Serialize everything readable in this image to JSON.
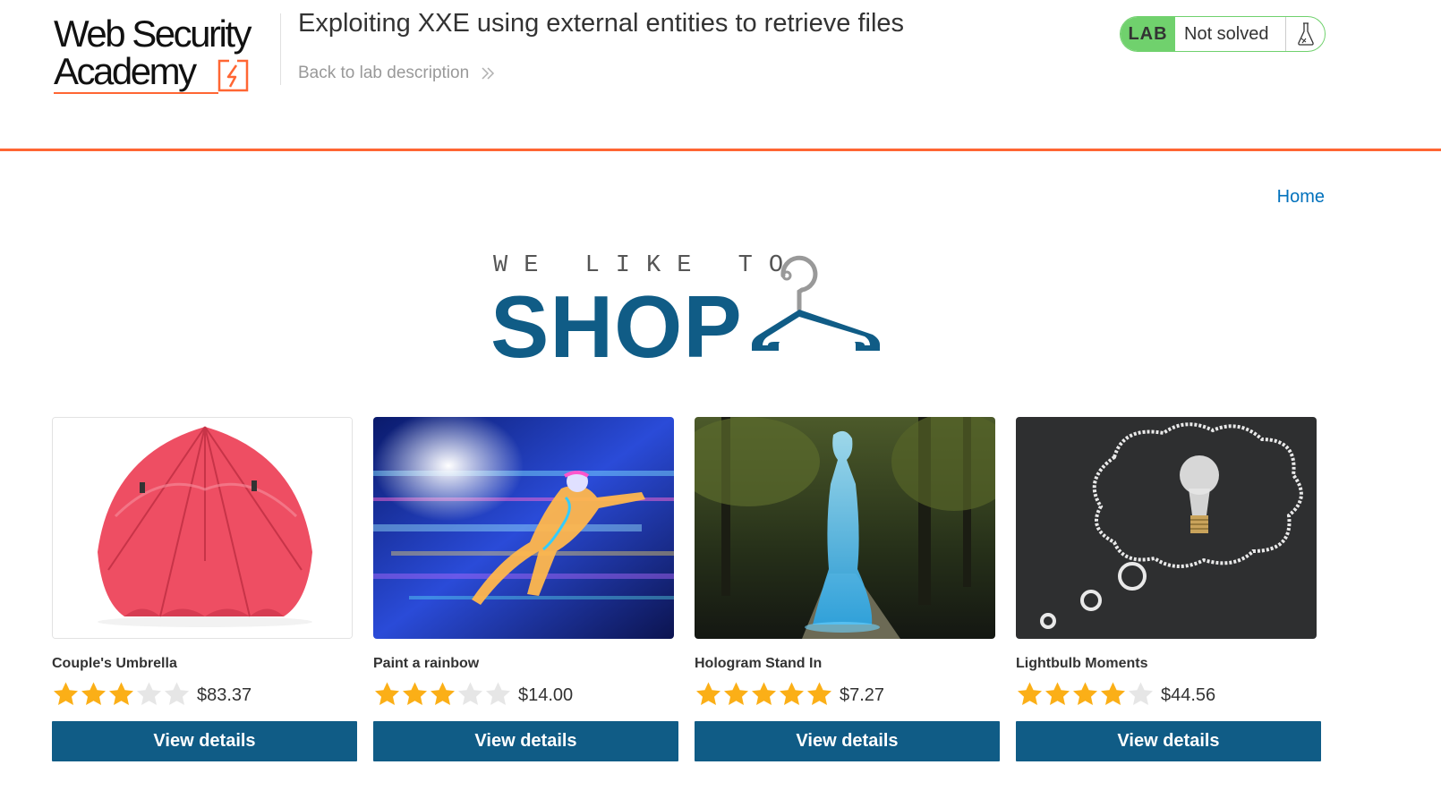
{
  "header": {
    "logo_line1": "Web Security",
    "logo_line2": "Academy",
    "lab_title": "Exploiting XXE using external entities to retrieve files",
    "back_link": "Back to lab description",
    "lab_badge": "LAB",
    "lab_status": "Not solved"
  },
  "nav": {
    "home": "Home"
  },
  "banner": {
    "tagline": "WE LIKE TO",
    "title": "SHOP"
  },
  "colors": {
    "brand_orange": "#ff6633",
    "primary_blue": "#105c86",
    "link_blue": "#0071bc",
    "lab_green": "#70d16d",
    "star_gold": "#fbaf17",
    "star_empty": "#e6e6e6"
  },
  "products": [
    {
      "name": "Couple's Umbrella",
      "rating": 3,
      "max_rating": 5,
      "price": "$83.37",
      "button": "View details",
      "image": "red-umbrella"
    },
    {
      "name": "Paint a rainbow",
      "rating": 3,
      "max_rating": 5,
      "price": "$14.00",
      "button": "View details",
      "image": "neon-runner"
    },
    {
      "name": "Hologram Stand In",
      "rating": 5,
      "max_rating": 5,
      "price": "$7.27",
      "button": "View details",
      "image": "hologram-woman-in-park"
    },
    {
      "name": "Lightbulb Moments",
      "rating": 4,
      "max_rating": 5,
      "price": "$44.56",
      "button": "View details",
      "image": "lightbulb-chalk-cloud"
    }
  ]
}
